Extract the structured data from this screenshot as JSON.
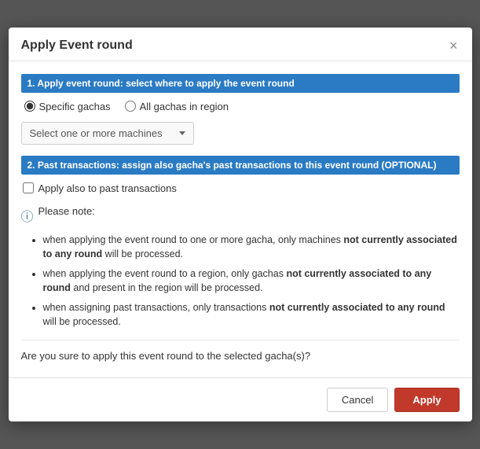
{
  "modal": {
    "title": "Apply Event round",
    "close_icon": "×",
    "step1": {
      "header": "1. Apply event round: select where to apply the event round",
      "options": [
        {
          "label": "Specific gachas",
          "value": "specific",
          "checked": true
        },
        {
          "label": "All gachas in region",
          "value": "all",
          "checked": false
        }
      ],
      "dropdown": {
        "label": "Select one or more machines",
        "placeholder": "Select one or more machines"
      }
    },
    "step2": {
      "header": "2. Past transactions: assign also gacha's past transactions to this event round (OPTIONAL)",
      "checkbox_label": "Apply also to past transactions",
      "checked": false
    },
    "note": {
      "prefix": "Please note:",
      "items": [
        {
          "text_normal": "when applying the event round to one or more gacha, only machines ",
          "text_bold": "not currently associated to any round",
          "text_normal2": " will be processed."
        },
        {
          "text_normal": "when applying the event round to a region, only gachas ",
          "text_bold": "not currently associated to any round",
          "text_normal2": " and present in the region will be processed."
        },
        {
          "text_normal": "when assigning past transactions, only transactions ",
          "text_bold": "not currently associated to any round",
          "text_normal2": " will be processed."
        }
      ]
    },
    "confirm_text": "Are you sure to apply this event round to the selected gacha(s)?",
    "footer": {
      "cancel_label": "Cancel",
      "apply_label": "Apply"
    }
  }
}
